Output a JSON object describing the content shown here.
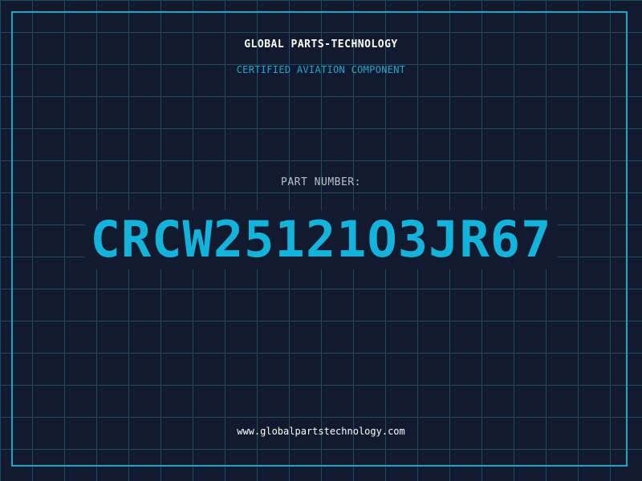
{
  "header": {
    "company": "GLOBAL PARTS-TECHNOLOGY",
    "subtitle": "CERTIFIED AVIATION COMPONENT"
  },
  "part": {
    "label": "PART NUMBER:",
    "number": "CRCW25121O3JR67"
  },
  "footer": {
    "url": "www.globalpartstechnology.com"
  },
  "colors": {
    "background": "#111a2e",
    "grid": "#1f4a5f",
    "frame": "#1aa6c9",
    "accent": "#12b4dc",
    "text": "#ffffff",
    "muted": "#b8c2cc"
  }
}
